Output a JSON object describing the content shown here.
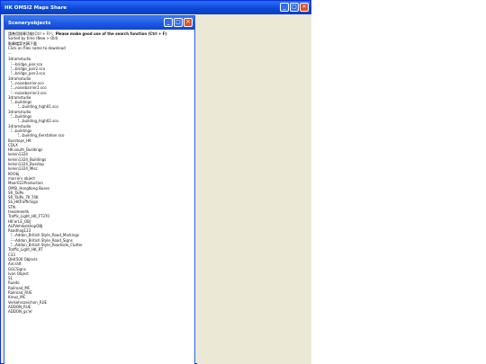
{
  "window": {
    "title": "HK OMSI2 Maps Share",
    "min": "_",
    "max": "□",
    "close": "✕"
  },
  "sub": {
    "title": "Sceneryobjects",
    "min": "_",
    "max": "□",
    "close": "✕"
  },
  "header": {
    "line1": "請善用搜尋功能(Ctrl + F)🔍",
    "line1_bold": "Please make good use of the search function (Ctrl + F)",
    "line2": "Sorted by time (New > Old)",
    "line3": "點擊檔案名稱下載",
    "line4": "Click on files name to download",
    "line5": "..."
  },
  "tree": [
    {
      "text": "3dramstudio",
      "level": 0
    },
    {
      "text": "bridge_pier.sco",
      "level": 1
    },
    {
      "text": "bridge_pier2.sco",
      "level": 1
    },
    {
      "text": "bridge_pier3.sco",
      "level": 1
    },
    {
      "text": "3dramstudio",
      "level": 0
    },
    {
      "text": "noisebarrier.sco",
      "level": 1
    },
    {
      "text": "noisebarrier2.sco",
      "level": 1
    },
    {
      "text": "noisebarrier3.sco",
      "level": 1
    },
    {
      "text": "3dramstudio",
      "level": 0
    },
    {
      "text": "buildings",
      "level": 1
    },
    {
      "text": "building_high01.sco",
      "level": 2
    },
    {
      "text": "3dramstudio",
      "level": 0
    },
    {
      "text": "buildings",
      "level": 1
    },
    {
      "text": "building_high02.sco",
      "level": 2
    },
    {
      "text": "3dramstudio",
      "level": 0
    },
    {
      "text": "buildings",
      "level": 1
    },
    {
      "text": "building_6erstation.sco",
      "level": 2
    },
    {
      "text": "Busstops_HK",
      "level": 0
    },
    {
      "text": "CDLX",
      "level": 0
    },
    {
      "text": "HK.south_Buildings",
      "level": 0
    },
    {
      "text": "kelvin1324",
      "level": 0
    },
    {
      "text": "kelvin1324_Buildings",
      "level": 0
    },
    {
      "text": "kelvin1324_Busstop",
      "level": 0
    },
    {
      "text": "kelvin1324_Misc",
      "level": 0
    },
    {
      "text": "KOObj",
      "level": 0
    },
    {
      "text": "marrie's object",
      "level": 0
    },
    {
      "text": "Moor022Production",
      "level": 0
    },
    {
      "text": "OMSI_HongKong Buses",
      "level": 0
    },
    {
      "text": "SR_TaiPo",
      "level": 0
    },
    {
      "text": "SR_TaiPo_7K 74K",
      "level": 0
    },
    {
      "text": "SS_HKTrafficSign",
      "level": 0
    },
    {
      "text": "STN",
      "level": 0
    },
    {
      "text": "tseolmeehk",
      "level": 0
    },
    {
      "text": "Traffic_Light_HK_FT370",
      "level": 0
    },
    {
      "text": "HK'w'LE_OBJ",
      "level": 0
    },
    {
      "text": "ALPVehikelshopOBJ",
      "level": 0
    },
    {
      "text": "Roadhog123",
      "level": 0
    },
    {
      "text": "Addon_British Style_Road_Markings",
      "level": 1
    },
    {
      "text": "Addon_British Style_Road_Signs",
      "level": 1
    },
    {
      "text": "Addon_British Style_Roadside_Clutter",
      "level": 1
    },
    {
      "text": "Traffic_Light_HK_RT",
      "level": 0
    },
    {
      "text": "C33",
      "level": 0
    },
    {
      "text": "QH4500 Objects",
      "level": 0
    },
    {
      "text": "Aircraft",
      "level": 0
    },
    {
      "text": "GGCSigns",
      "level": 0
    },
    {
      "text": "Ivan Object",
      "level": 0
    },
    {
      "text": "S1",
      "level": 0
    },
    {
      "text": "Ruedo",
      "level": 0
    },
    {
      "text": "Railroad_MC",
      "level": 0
    },
    {
      "text": "Railroad_RUE",
      "level": 0
    },
    {
      "text": "Kreuz_MC",
      "level": 0
    },
    {
      "text": "Verkehrszeichen_RUE",
      "level": 0
    },
    {
      "text": "ADDON_RUE",
      "level": 0
    },
    {
      "text": "ADDON_gc'w'",
      "level": 0
    }
  ]
}
